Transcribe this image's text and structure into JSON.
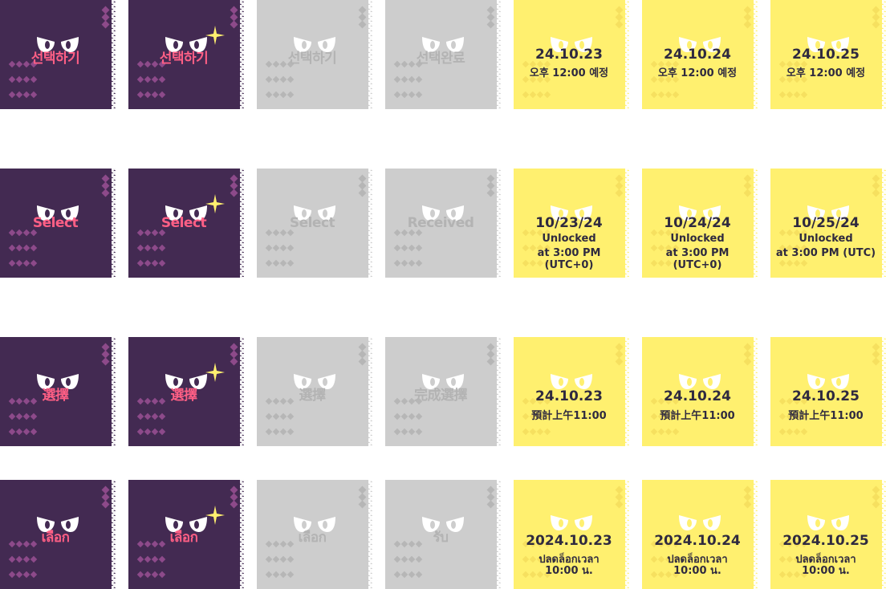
{
  "colors": {
    "purple": "#432a52",
    "pink_text": "#ff5f85",
    "gray": "#cdcdcd",
    "gray_text": "#b3b3b3",
    "yellow": "#fff06f",
    "dark_text": "#2f2a3f",
    "sparkle": "#fff06f"
  },
  "icons": {
    "eyes": "cat-eyes-icon",
    "sparkle": "sparkle-icon",
    "diamonds": "diamond-pattern-icon"
  },
  "rows": [
    {
      "lang": "ko",
      "select": "선택하기",
      "select_hover": "선택하기",
      "select_disabled": "선택하기",
      "done": "선택완료",
      "dates": [
        {
          "date": "24.10.23",
          "line1": "오후 12:00 예정",
          "line2": ""
        },
        {
          "date": "24.10.24",
          "line1": "오후 12:00 예정",
          "line2": ""
        },
        {
          "date": "24.10.25",
          "line1": "오후 12:00 예정",
          "line2": ""
        }
      ]
    },
    {
      "lang": "en",
      "select": "Select",
      "select_hover": "Select",
      "select_disabled": "Select",
      "done": "Received",
      "dates": [
        {
          "date": "10/23/24",
          "line1": "Unlocked",
          "line2": "at 3:00 PM (UTC+0)"
        },
        {
          "date": "10/24/24",
          "line1": "Unlocked",
          "line2": "at 3:00 PM (UTC+0)"
        },
        {
          "date": "10/25/24",
          "line1": "Unlocked",
          "line2": "at 3:00 PM (UTC)"
        }
      ]
    },
    {
      "lang": "zh",
      "select": "選擇",
      "select_hover": "選擇",
      "select_disabled": "選擇",
      "done": "完成選擇",
      "dates": [
        {
          "date": "24.10.23",
          "line1": "預計上午11:00",
          "line2": ""
        },
        {
          "date": "24.10.24",
          "line1": "預計上午11:00",
          "line2": ""
        },
        {
          "date": "24.10.25",
          "line1": "預計上午11:00",
          "line2": ""
        }
      ]
    },
    {
      "lang": "th",
      "select": "เลือก",
      "select_hover": "เลือก",
      "select_disabled": "เลือก",
      "done": "รับ",
      "dates": [
        {
          "date": "2024.10.23",
          "line1": "ปลดล็อกเวลา",
          "line2": "10:00 น."
        },
        {
          "date": "2024.10.24",
          "line1": "ปลดล็อกเวลา",
          "line2": "10:00 น."
        },
        {
          "date": "2024.10.25",
          "line1": "ปลดล็อกเวลา",
          "line2": "10:00 น."
        }
      ]
    }
  ]
}
